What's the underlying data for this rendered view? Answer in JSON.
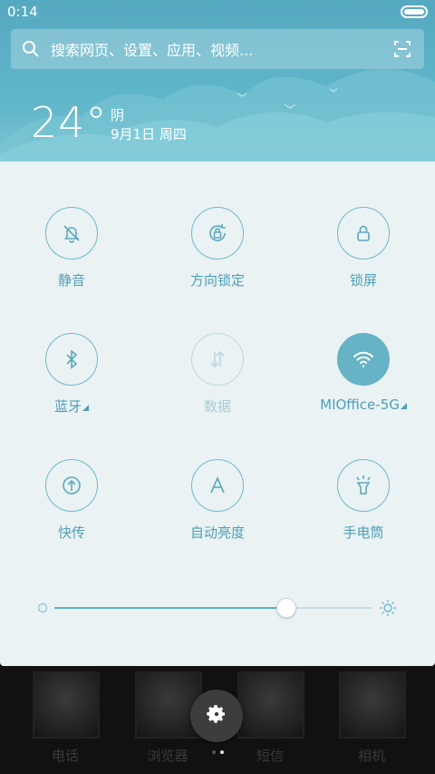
{
  "status_bar": {
    "time": "0:14"
  },
  "search": {
    "placeholder": "搜索网页、设置、应用、视频..."
  },
  "weather": {
    "temperature": "24°",
    "condition": "阴",
    "date": "9月1日 周四"
  },
  "toggles": [
    {
      "label": "静音",
      "icon": "bell-off-icon",
      "state": "off"
    },
    {
      "label": "方向锁定",
      "icon": "rotation-lock-icon",
      "state": "off"
    },
    {
      "label": "锁屏",
      "icon": "lock-icon",
      "state": "off"
    },
    {
      "label": "蓝牙",
      "icon": "bluetooth-icon",
      "state": "off",
      "has_menu": true
    },
    {
      "label": "数据",
      "icon": "data-arrows-icon",
      "state": "disabled"
    },
    {
      "label": "MIOffice-5G",
      "icon": "wifi-icon",
      "state": "on",
      "has_menu": true
    },
    {
      "label": "快传",
      "icon": "share-transfer-icon",
      "state": "off"
    },
    {
      "label": "自动亮度",
      "icon": "auto-brightness-icon",
      "state": "off"
    },
    {
      "label": "手电筒",
      "icon": "flashlight-icon",
      "state": "off"
    }
  ],
  "brightness": {
    "level": 0.73
  },
  "dock": {
    "apps": [
      "电话",
      "浏览器",
      "短信",
      "相机"
    ]
  },
  "page_indicator": {
    "pages": 2,
    "current": 2
  },
  "colors": {
    "accent": "#67b3c6",
    "panel_bg": "#eaf2f4",
    "header_bg": "#5fb5c9"
  }
}
